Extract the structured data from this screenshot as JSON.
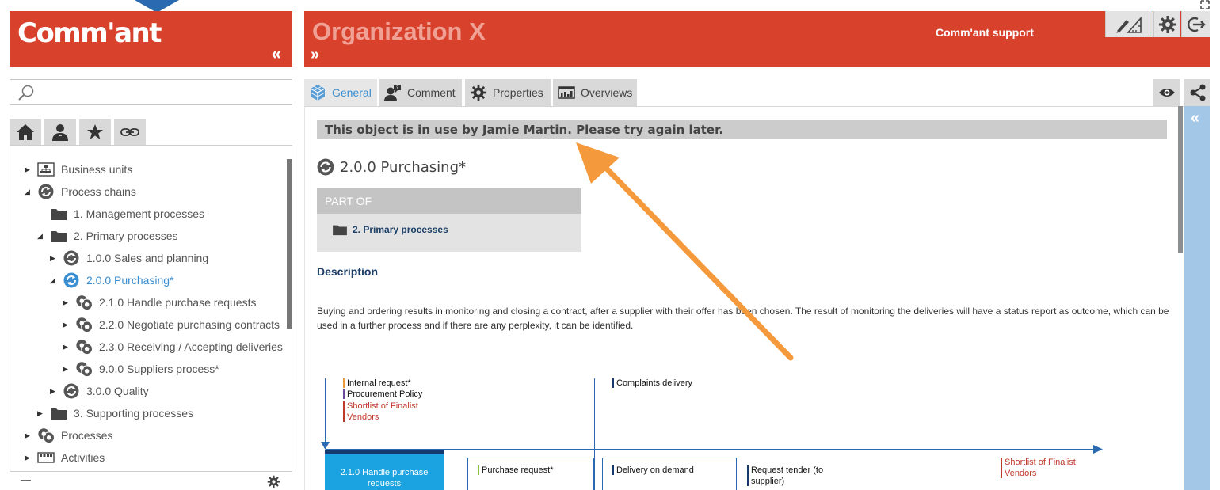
{
  "brand": {
    "logo_text": "Comm'ant",
    "collapse_glyph": "«"
  },
  "header": {
    "org_title": "Organization X",
    "expand_glyph": "»",
    "support_label": "Comm'ant support"
  },
  "search": {
    "placeholder": "",
    "value": ""
  },
  "tree": {
    "items": [
      {
        "label": "Business units"
      },
      {
        "label": "Process chains"
      },
      {
        "label": "1. Management processes"
      },
      {
        "label": "2. Primary processes"
      },
      {
        "label": "1.0.0 Sales and planning"
      },
      {
        "label": "2.0.0 Purchasing*"
      },
      {
        "label": "2.1.0 Handle purchase requests"
      },
      {
        "label": "2.2.0 Negotiate purchasing contracts"
      },
      {
        "label": "2.3.0 Receiving / Accepting deliveries"
      },
      {
        "label": "9.0.0 Suppliers process*"
      },
      {
        "label": "3.0.0 Quality"
      },
      {
        "label": "3. Supporting processes"
      },
      {
        "label": "Processes"
      },
      {
        "label": "Activities"
      }
    ],
    "footer_dash": "—"
  },
  "tabs": [
    {
      "label": "General"
    },
    {
      "label": "Comment"
    },
    {
      "label": "Properties"
    },
    {
      "label": "Overviews"
    }
  ],
  "content": {
    "lock_message": "This object is in use by Jamie Martin. Please try again later.",
    "object_title": "2.0.0 Purchasing*",
    "part_of": {
      "heading": "PART OF",
      "link": "2. Primary processes"
    },
    "description": {
      "heading": "Description",
      "text": "Buying and ordering results in monitoring and closing a contract, after a supplier with their offer has been chosen. The result of monitoring the deliveries will have a status report as outcome, which can be used in a further process and if there are any perplexity, it can be identified."
    }
  },
  "side_panel": {
    "collapse_glyph": "«"
  },
  "diagram": {
    "inputs": [
      {
        "text": "Internal request*",
        "color": "#e89a3c"
      },
      {
        "text": "Procurement Policy",
        "color": "#6b4aa0"
      },
      {
        "text": "Shortlist of Finalist Vendors",
        "color": "#c0392b"
      }
    ],
    "complaints_label": "Complaints delivery",
    "process_box": "2.1.0 Handle purchase requests",
    "outputs": [
      {
        "text": "Purchase request*",
        "color": "#8bbf3c"
      },
      {
        "text": "Delivery on demand",
        "color": "#16396e"
      },
      {
        "text": "Request tender (to supplier)",
        "color": "#16396e"
      }
    ],
    "right_output": {
      "text": "Shortlist of Finalist Vendors",
      "color": "#c0392b"
    }
  },
  "colors": {
    "brand_red": "#d8412b",
    "org_title": "#f0a195",
    "accent_blue": "#3b8fd0",
    "dark_navy": "#1d3f66",
    "annotation_arrow": "#f59a3c"
  }
}
